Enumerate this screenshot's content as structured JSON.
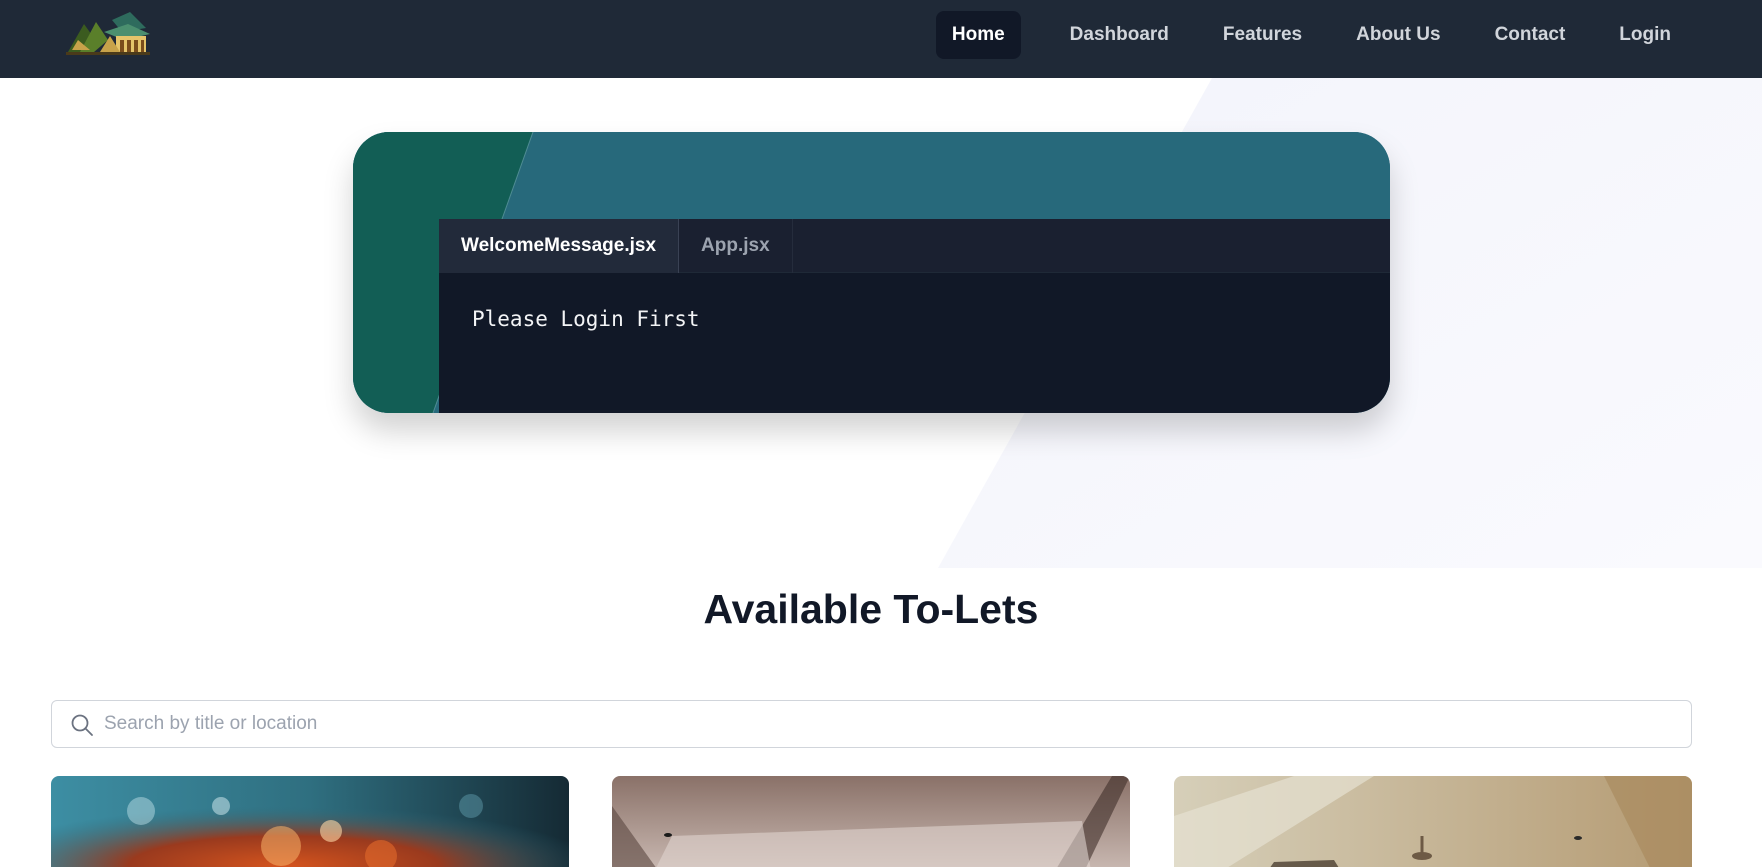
{
  "nav": {
    "logo_icon": "house-logo-icon",
    "links": [
      {
        "label": "Home",
        "active": true
      },
      {
        "label": "Dashboard",
        "active": false
      },
      {
        "label": "Features",
        "active": false
      },
      {
        "label": "About Us",
        "active": false
      },
      {
        "label": "Contact",
        "active": false
      },
      {
        "label": "Login",
        "active": false
      }
    ]
  },
  "hero": {
    "tabs": [
      {
        "label": "WelcomeMessage.jsx",
        "active": true
      },
      {
        "label": "App.jsx",
        "active": false
      }
    ],
    "code_text": "Please Login First"
  },
  "listings": {
    "title": "Available To-Lets",
    "search": {
      "placeholder": "Search by title or location",
      "value": "",
      "icon": "search-icon"
    },
    "cards": [
      {
        "image": "bokeh-photo"
      },
      {
        "image": "room-ceiling-photo"
      },
      {
        "image": "room-ceiling-fan-photo"
      }
    ]
  },
  "colors": {
    "navbar_bg": "#1f2937",
    "nav_active_bg": "#111827",
    "card_teal": "#27697b",
    "card_dark_teal": "#125e55",
    "editor_bg": "#111827",
    "title_color": "#111827"
  }
}
